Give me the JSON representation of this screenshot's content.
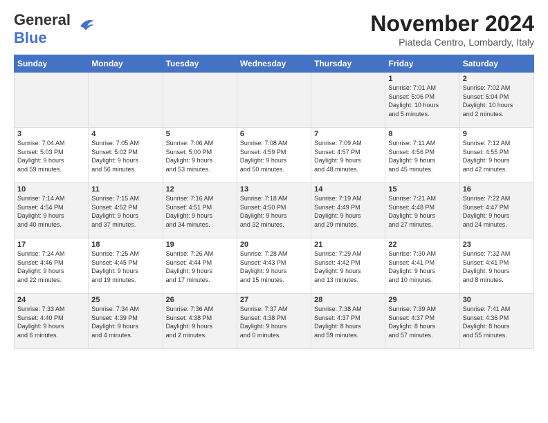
{
  "logo": {
    "part1": "General",
    "part2": "Blue"
  },
  "title": "November 2024",
  "subtitle": "Piateda Centro, Lombardy, Italy",
  "days_of_week": [
    "Sunday",
    "Monday",
    "Tuesday",
    "Wednesday",
    "Thursday",
    "Friday",
    "Saturday"
  ],
  "weeks": [
    [
      {
        "day": "",
        "info": ""
      },
      {
        "day": "",
        "info": ""
      },
      {
        "day": "",
        "info": ""
      },
      {
        "day": "",
        "info": ""
      },
      {
        "day": "",
        "info": ""
      },
      {
        "day": "1",
        "info": "Sunrise: 7:01 AM\nSunset: 5:06 PM\nDaylight: 10 hours\nand 5 minutes."
      },
      {
        "day": "2",
        "info": "Sunrise: 7:02 AM\nSunset: 5:04 PM\nDaylight: 10 hours\nand 2 minutes."
      }
    ],
    [
      {
        "day": "3",
        "info": "Sunrise: 7:04 AM\nSunset: 5:03 PM\nDaylight: 9 hours\nand 59 minutes."
      },
      {
        "day": "4",
        "info": "Sunrise: 7:05 AM\nSunset: 5:02 PM\nDaylight: 9 hours\nand 56 minutes."
      },
      {
        "day": "5",
        "info": "Sunrise: 7:06 AM\nSunset: 5:00 PM\nDaylight: 9 hours\nand 53 minutes."
      },
      {
        "day": "6",
        "info": "Sunrise: 7:08 AM\nSunset: 4:59 PM\nDaylight: 9 hours\nand 50 minutes."
      },
      {
        "day": "7",
        "info": "Sunrise: 7:09 AM\nSunset: 4:57 PM\nDaylight: 9 hours\nand 48 minutes."
      },
      {
        "day": "8",
        "info": "Sunrise: 7:11 AM\nSunset: 4:56 PM\nDaylight: 9 hours\nand 45 minutes."
      },
      {
        "day": "9",
        "info": "Sunrise: 7:12 AM\nSunset: 4:55 PM\nDaylight: 9 hours\nand 42 minutes."
      }
    ],
    [
      {
        "day": "10",
        "info": "Sunrise: 7:14 AM\nSunset: 4:54 PM\nDaylight: 9 hours\nand 40 minutes."
      },
      {
        "day": "11",
        "info": "Sunrise: 7:15 AM\nSunset: 4:52 PM\nDaylight: 9 hours\nand 37 minutes."
      },
      {
        "day": "12",
        "info": "Sunrise: 7:16 AM\nSunset: 4:51 PM\nDaylight: 9 hours\nand 34 minutes."
      },
      {
        "day": "13",
        "info": "Sunrise: 7:18 AM\nSunset: 4:50 PM\nDaylight: 9 hours\nand 32 minutes."
      },
      {
        "day": "14",
        "info": "Sunrise: 7:19 AM\nSunset: 4:49 PM\nDaylight: 9 hours\nand 29 minutes."
      },
      {
        "day": "15",
        "info": "Sunrise: 7:21 AM\nSunset: 4:48 PM\nDaylight: 9 hours\nand 27 minutes."
      },
      {
        "day": "16",
        "info": "Sunrise: 7:22 AM\nSunset: 4:47 PM\nDaylight: 9 hours\nand 24 minutes."
      }
    ],
    [
      {
        "day": "17",
        "info": "Sunrise: 7:24 AM\nSunset: 4:46 PM\nDaylight: 9 hours\nand 22 minutes."
      },
      {
        "day": "18",
        "info": "Sunrise: 7:25 AM\nSunset: 4:45 PM\nDaylight: 9 hours\nand 19 minutes."
      },
      {
        "day": "19",
        "info": "Sunrise: 7:26 AM\nSunset: 4:44 PM\nDaylight: 9 hours\nand 17 minutes."
      },
      {
        "day": "20",
        "info": "Sunrise: 7:28 AM\nSunset: 4:43 PM\nDaylight: 9 hours\nand 15 minutes."
      },
      {
        "day": "21",
        "info": "Sunrise: 7:29 AM\nSunset: 4:42 PM\nDaylight: 9 hours\nand 13 minutes."
      },
      {
        "day": "22",
        "info": "Sunrise: 7:30 AM\nSunset: 4:41 PM\nDaylight: 9 hours\nand 10 minutes."
      },
      {
        "day": "23",
        "info": "Sunrise: 7:32 AM\nSunset: 4:41 PM\nDaylight: 9 hours\nand 8 minutes."
      }
    ],
    [
      {
        "day": "24",
        "info": "Sunrise: 7:33 AM\nSunset: 4:40 PM\nDaylight: 9 hours\nand 6 minutes."
      },
      {
        "day": "25",
        "info": "Sunrise: 7:34 AM\nSunset: 4:39 PM\nDaylight: 9 hours\nand 4 minutes."
      },
      {
        "day": "26",
        "info": "Sunrise: 7:36 AM\nSunset: 4:38 PM\nDaylight: 9 hours\nand 2 minutes."
      },
      {
        "day": "27",
        "info": "Sunrise: 7:37 AM\nSunset: 4:38 PM\nDaylight: 9 hours\nand 0 minutes."
      },
      {
        "day": "28",
        "info": "Sunrise: 7:38 AM\nSunset: 4:37 PM\nDaylight: 8 hours\nand 59 minutes."
      },
      {
        "day": "29",
        "info": "Sunrise: 7:39 AM\nSunset: 4:37 PM\nDaylight: 8 hours\nand 57 minutes."
      },
      {
        "day": "30",
        "info": "Sunrise: 7:41 AM\nSunset: 4:36 PM\nDaylight: 8 hours\nand 55 minutes."
      }
    ]
  ]
}
